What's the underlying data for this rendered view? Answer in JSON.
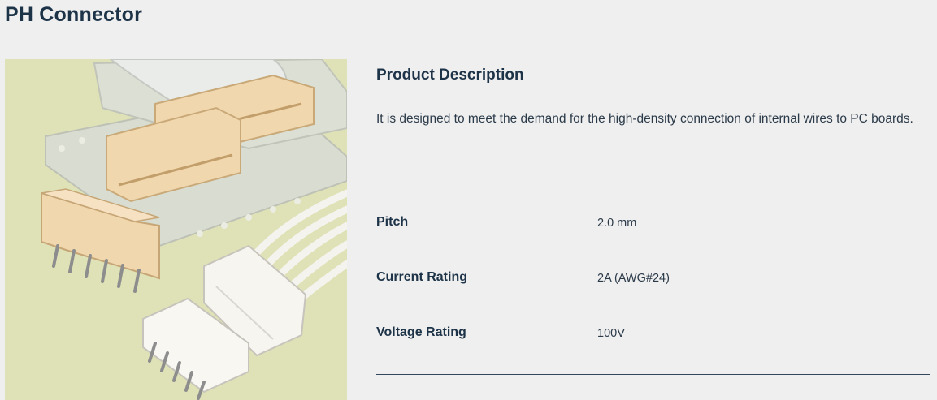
{
  "page": {
    "title": "PH Connector"
  },
  "image": {
    "subject": "connector-photo",
    "colors": {
      "background": "#dfe2b8",
      "housing": "#f1d9b2",
      "white_housing": "#f7f5ef",
      "tape": "#d6dad4",
      "pins": "#9a9a9a"
    }
  },
  "product": {
    "description_heading": "Product Description",
    "description": "It is designed to meet the demand for the high-density connection of internal wires to PC boards.",
    "specs": [
      {
        "label": "Pitch",
        "value": "2.0 mm"
      },
      {
        "label": "Current Rating",
        "value": "2A (AWG#24)"
      },
      {
        "label": "Voltage Rating",
        "value": "100V"
      }
    ]
  },
  "colors": {
    "background": "#efefef",
    "text": "#1d3348",
    "rule": "#33485c"
  }
}
